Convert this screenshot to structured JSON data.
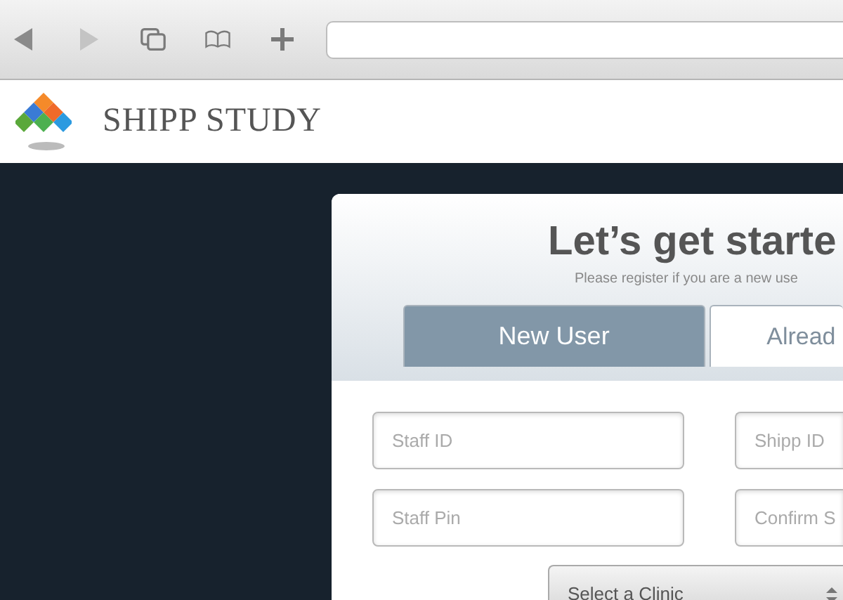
{
  "header": {
    "brand": "SHIPP STUDY"
  },
  "card": {
    "title": "Let’s get starte",
    "subtitle": "Please register if you are a new use",
    "tabs": [
      {
        "label": "New User",
        "selected": true
      },
      {
        "label": "Alread",
        "selected": false
      }
    ],
    "fields": [
      {
        "placeholder": "Staff ID"
      },
      {
        "placeholder": "Shipp ID"
      },
      {
        "placeholder": "Staff Pin"
      },
      {
        "placeholder": "Confirm S"
      }
    ],
    "select": {
      "value": "Select a Clinic"
    }
  }
}
